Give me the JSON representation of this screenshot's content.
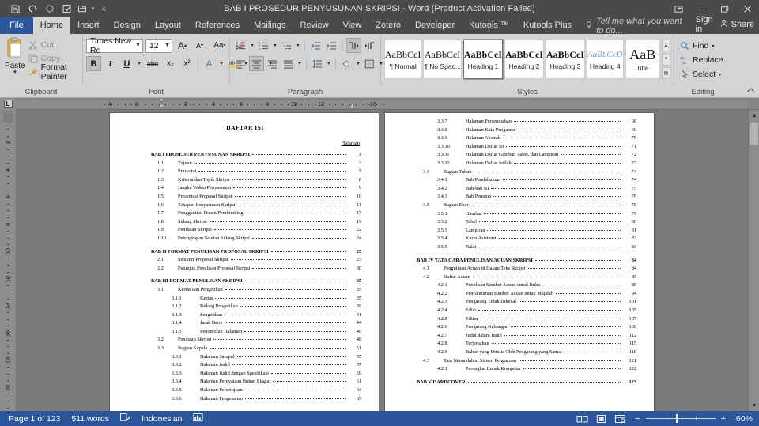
{
  "window": {
    "title": "BAB I PROSEDUR PENYUSUNAN SKRIPSI - Word (Product Activation Failed)",
    "quick_access": [
      {
        "name": "save-icon",
        "glyph": "ὋE"
      },
      {
        "name": "undo-icon",
        "glyph": "↺"
      },
      {
        "name": "redo-icon",
        "glyph": "○"
      },
      {
        "name": "touch-mode-icon",
        "glyph": "☑"
      },
      {
        "name": "customize-quick-access-icon",
        "glyph": "▾"
      }
    ],
    "controls": {
      "ribbon_display_options": "⊞",
      "minimize": "—",
      "restore": "❐",
      "close": "✕"
    }
  },
  "tabs": [
    {
      "label": "File",
      "type": "file"
    },
    {
      "label": "Home",
      "active": true
    },
    {
      "label": "Insert"
    },
    {
      "label": "Design"
    },
    {
      "label": "Layout"
    },
    {
      "label": "References"
    },
    {
      "label": "Mailings"
    },
    {
      "label": "Review"
    },
    {
      "label": "View"
    },
    {
      "label": "Zotero"
    },
    {
      "label": "Developer"
    },
    {
      "label": "Kutools ™"
    },
    {
      "label": "Kutools Plus"
    }
  ],
  "tell_me": {
    "placeholder": "Tell me what you want to do...",
    "icon": "lightbulb-icon"
  },
  "account": {
    "sign_in": "Sign in",
    "share": "Share"
  },
  "ribbon": {
    "clipboard": {
      "label": "Clipboard",
      "paste": "Paste",
      "cut": "Cut",
      "copy": "Copy",
      "format_painter": "Format Painter"
    },
    "font": {
      "label": "Font",
      "font_name": "Times New Ro",
      "font_size": "12",
      "grow_font": "A",
      "shrink_font": "A",
      "change_case": "Aa",
      "clear_formatting": "⌫",
      "bold": "B",
      "italic": "I",
      "underline": "U",
      "strikethrough": "abc",
      "subscript": "x₂",
      "superscript": "x²",
      "text_effects": "A",
      "text_highlight": "ab",
      "font_color": "A"
    },
    "paragraph": {
      "label": "Paragraph",
      "bullets": "≣",
      "numbering": "≣",
      "multilevel_list": "≣",
      "decrease_indent": "⇤",
      "increase_indent": "⇥",
      "ltr_text": "¶",
      "rtl_text": "¶",
      "sort": "A↓",
      "show_marks": "¶",
      "align_left": "≡",
      "align_center": "≡",
      "align_right": "≡",
      "justify": "≡",
      "line_spacing": "↕",
      "shading": "△",
      "borders": "⊞"
    },
    "styles": {
      "label": "Styles",
      "items": [
        {
          "preview": "AaBbCcI",
          "name": "¶ Normal",
          "selected": false
        },
        {
          "preview": "AaBbCcI",
          "name": "¶ No Spac...",
          "selected": false
        },
        {
          "preview": "AaBbCcI",
          "name": "Heading 1",
          "selected": true
        },
        {
          "preview": "AaBbCcI",
          "name": "Heading 2",
          "selected": false
        },
        {
          "preview": "AaBbCcI",
          "name": "Heading 3",
          "selected": false
        },
        {
          "preview": "AaBbCcD",
          "name": "Heading 4",
          "selected": false
        },
        {
          "preview": "AaB",
          "name": "Title",
          "selected": false
        }
      ]
    },
    "editing": {
      "label": "Editing",
      "find": "Find",
      "replace": "Replace",
      "select": "Select"
    },
    "collapse_ribbon": "^"
  },
  "rulers": {
    "horizontal": [
      "4",
      "2",
      "2",
      "4",
      "6",
      "8",
      "10",
      "12",
      "16"
    ],
    "vertical": [
      "2",
      "4",
      "6",
      "8",
      "10",
      "12",
      "14",
      "16",
      "18",
      "20",
      "22"
    ]
  },
  "document": {
    "page_left": {
      "title": "DAFTAR ISI",
      "page_col_header": "Halaman",
      "entries": [
        {
          "level": 0,
          "num": "",
          "label": "BAB I PROSEDUR PENYUSUNAN SKRIPSI",
          "page": "3",
          "space_before": false
        },
        {
          "level": 1,
          "num": "1.1",
          "label": "Tujuan",
          "page": "3"
        },
        {
          "level": 1,
          "num": "1.2",
          "label": "Prasyarat",
          "page": "5"
        },
        {
          "level": 1,
          "num": "1.3",
          "label": "Kriteria dan Topik Skripsi",
          "page": "8"
        },
        {
          "level": 1,
          "num": "1.4",
          "label": "Jangka Waktu Penyusunan",
          "page": "9"
        },
        {
          "level": 1,
          "num": "1.5",
          "label": "Presentasi Proposal Skripsi",
          "page": "10"
        },
        {
          "level": 1,
          "num": "1.6",
          "label": "Tahapan Penyusunan Skripsi",
          "page": "11"
        },
        {
          "level": 1,
          "num": "1.7",
          "label": "Penggantian Dosen Pembimbing",
          "page": "17"
        },
        {
          "level": 1,
          "num": "1.8",
          "label": "Sidang Skripsi",
          "page": "19"
        },
        {
          "level": 1,
          "num": "1.9",
          "label": "Penilaian Skripsi",
          "page": "22"
        },
        {
          "level": 1,
          "num": "1.10",
          "label": "Pelengkapan Setelah Sidang Skripsi",
          "page": "24"
        },
        {
          "level": 0,
          "num": "",
          "label": "BAB II FORMAT PENULISAN PROPOSAL SKRIPSI",
          "page": "25",
          "space_before": true
        },
        {
          "level": 1,
          "num": "2.1",
          "label": "Struktur Proposal Skripsi",
          "page": "25"
        },
        {
          "level": 1,
          "num": "2.2",
          "label": "Petunjuk Penulisan Proposal Skripsi",
          "page": "30"
        },
        {
          "level": 0,
          "num": "",
          "label": "BAB III FORMAT PENULISAN SKRIPSI",
          "page": "35",
          "space_before": true
        },
        {
          "level": 1,
          "num": "3.1",
          "label": "Kertas dan Pengetikan",
          "page": "35"
        },
        {
          "level": 2,
          "num": "3.1.1",
          "label": "Kertas",
          "page": "35"
        },
        {
          "level": 2,
          "num": "3.1.2",
          "label": "Bidang Pengetikan",
          "page": "39"
        },
        {
          "level": 2,
          "num": "3.1.3",
          "label": "Pengetikan",
          "page": "41"
        },
        {
          "level": 2,
          "num": "3.1.4",
          "label": "Jarak Baris",
          "page": "44"
        },
        {
          "level": 2,
          "num": "3.1.5",
          "label": "Penomoran Halaman",
          "page": "46"
        },
        {
          "level": 1,
          "num": "3.2",
          "label": "Penataan Skripsi",
          "page": "48"
        },
        {
          "level": 1,
          "num": "3.3",
          "label": "Bagian Kepala",
          "page": "51"
        },
        {
          "level": 2,
          "num": "3.3.1",
          "label": "Halaman Sampul",
          "page": "55"
        },
        {
          "level": 2,
          "num": "3.3.2",
          "label": "Halaman Judul",
          "page": "57"
        },
        {
          "level": 2,
          "num": "3.3.3",
          "label": "Halaman Judul dengan Spesifikasi",
          "page": "59"
        },
        {
          "level": 2,
          "num": "3.3.4",
          "label": "Halaman Pernyataan Bukan Plagiat",
          "page": "61"
        },
        {
          "level": 2,
          "num": "3.3.5",
          "label": "Halaman Persetujuan",
          "page": "63"
        },
        {
          "level": 2,
          "num": "3.3.6",
          "label": "Halaman Pengesahan",
          "page": "65"
        }
      ]
    },
    "page_right": {
      "entries": [
        {
          "level": 2,
          "num": "3.3.7",
          "label": "Halaman Persembahan",
          "page": "68"
        },
        {
          "level": 2,
          "num": "3.3.8",
          "label": "Halaman Kata Pengantar",
          "page": "69"
        },
        {
          "level": 2,
          "num": "3.3.9",
          "label": "Halaman Abstrak",
          "page": "70"
        },
        {
          "level": 2,
          "num": "3.3.10",
          "label": "Halaman Daftar Isi",
          "page": "71"
        },
        {
          "level": 2,
          "num": "3.3.11",
          "label": "Halaman Daftar Gambar, Tabel, dan Lampiran",
          "page": "72"
        },
        {
          "level": 2,
          "num": "3.3.12",
          "label": "Halaman Daftar Istilah",
          "page": "73"
        },
        {
          "level": 1,
          "num": "3.4",
          "label": "Bagian Tubuh",
          "page": "74"
        },
        {
          "level": 2,
          "num": "3.4.1",
          "label": "Bab Pendahuluan",
          "page": "74"
        },
        {
          "level": 2,
          "num": "3.4.2",
          "label": "Bab-bab Isi",
          "page": "75"
        },
        {
          "level": 2,
          "num": "3.4.3",
          "label": "Bab Penutup",
          "page": "76"
        },
        {
          "level": 1,
          "num": "3.5",
          "label": "Bagian Ekor",
          "page": "78"
        },
        {
          "level": 2,
          "num": "3.5.1",
          "label": "Gambar",
          "page": "79"
        },
        {
          "level": 2,
          "num": "3.5.2",
          "label": "Tabel",
          "page": "80"
        },
        {
          "level": 2,
          "num": "3.5.3",
          "label": "Lampiran",
          "page": "81"
        },
        {
          "level": 2,
          "num": "3.5.4",
          "label": "Kartu Asistensi",
          "page": "82"
        },
        {
          "level": 2,
          "num": "3.5.5",
          "label": "Ralat",
          "page": "83"
        },
        {
          "level": 0,
          "num": "",
          "label": "BAB IV TATA CARA PENULISAN ACUAN SKRIPSI",
          "page": "84",
          "space_before": true
        },
        {
          "level": 1,
          "num": "4.1",
          "label": "Pengutipan Acuan di Dalam Teks Skripsi",
          "page": "84"
        },
        {
          "level": 1,
          "num": "4.2",
          "label": "Daftar Acuan",
          "page": "85"
        },
        {
          "level": 2,
          "num": "4.2.1",
          "label": "Penulisan Sumber Acuan untuk Buku",
          "page": "85"
        },
        {
          "level": 2,
          "num": "4.2.2",
          "label": "Pencantuman Sumber Acuan untuk Majalah",
          "page": "94"
        },
        {
          "level": 2,
          "num": "4.2.3",
          "label": "Pengarang Tidak Dikenal",
          "page": "101"
        },
        {
          "level": 2,
          "num": "4.2.4",
          "label": "Edisi",
          "page": "105"
        },
        {
          "level": 2,
          "num": "4.2.5",
          "label": "Editor",
          "page": "107"
        },
        {
          "level": 2,
          "num": "4.2.6",
          "label": "Pengarang Gabungan",
          "page": "109"
        },
        {
          "level": 2,
          "num": "4.2.7",
          "label": "Judul dalam Judul",
          "page": "112"
        },
        {
          "level": 2,
          "num": "4.2.8",
          "label": "Terjemahan",
          "page": "115"
        },
        {
          "level": 2,
          "num": "4.2.9",
          "label": "Bahan yang Ditulis Oleh Pengarang yang Sama",
          "page": "118"
        },
        {
          "level": 1,
          "num": "4.3",
          "label": "Tata Nama dalam Sistem Pengacuan",
          "page": "121"
        },
        {
          "level": 2,
          "num": "4.2.1",
          "label": "Perangkat Lunak Komputer",
          "page": "122"
        },
        {
          "level": 0,
          "num": "",
          "label": "BAB V HARDCOVER",
          "page": "123",
          "space_before": true
        }
      ]
    }
  },
  "status_bar": {
    "page_indicator": "Page 1 of 123",
    "word_count": "511 words",
    "proofing_icon": "spell-check-icon",
    "language": "Indonesian",
    "macro_icon": "macro-recording-icon",
    "views": [
      {
        "name": "read-mode-view-button",
        "glyph": "▭"
      },
      {
        "name": "print-layout-view-button",
        "glyph": "▣"
      },
      {
        "name": "web-layout-view-button",
        "glyph": "▤"
      }
    ],
    "zoom_out": "−",
    "zoom_in": "+",
    "zoom_level": "60%"
  }
}
